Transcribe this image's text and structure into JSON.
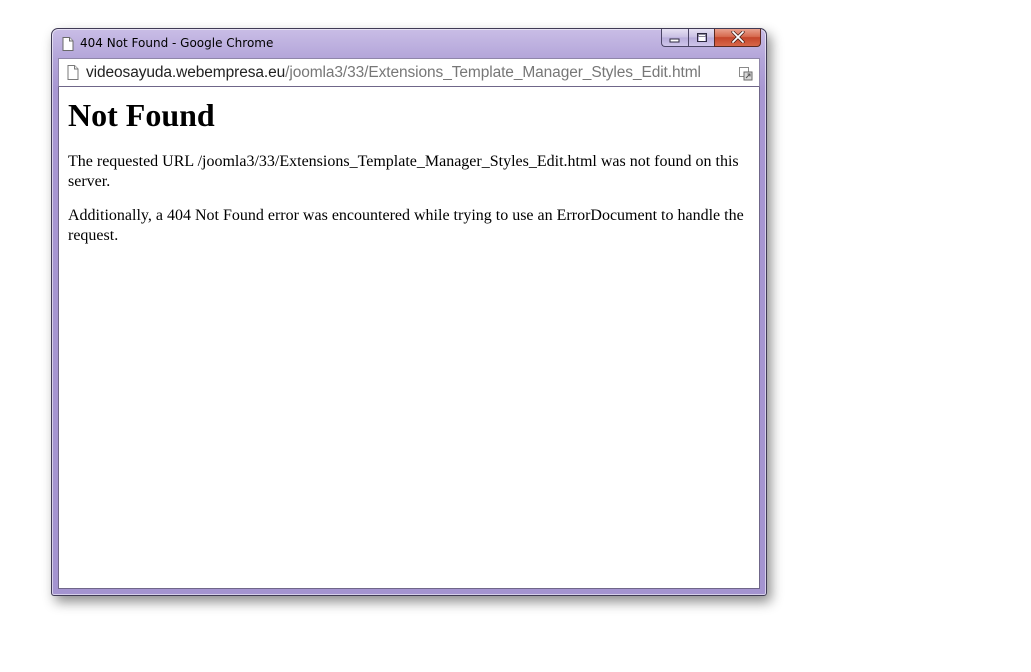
{
  "window": {
    "title": "404 Not Found - Google Chrome",
    "title_icon": "page-icon",
    "buttons": {
      "minimize_icon": "minimize-icon",
      "maximize_icon": "maximize-icon",
      "close_icon": "close-icon",
      "close_color": "#c4452a"
    }
  },
  "address_bar": {
    "host": "videosayuda.webempresa.eu",
    "path": "/joomla3/33/Extensions_Template_Manager_Styles_Edit.html",
    "page_icon": "page-icon",
    "action_icon": "open-in-chrome-icon"
  },
  "page": {
    "heading": "Not Found",
    "paragraphs": [
      "The requested URL /joomla3/33/Extensions_Template_Manager_Styles_Edit.html was not found on this server.",
      "Additionally, a 404 Not Found error was encountered while trying to use an ErrorDocument to handle the request."
    ]
  }
}
